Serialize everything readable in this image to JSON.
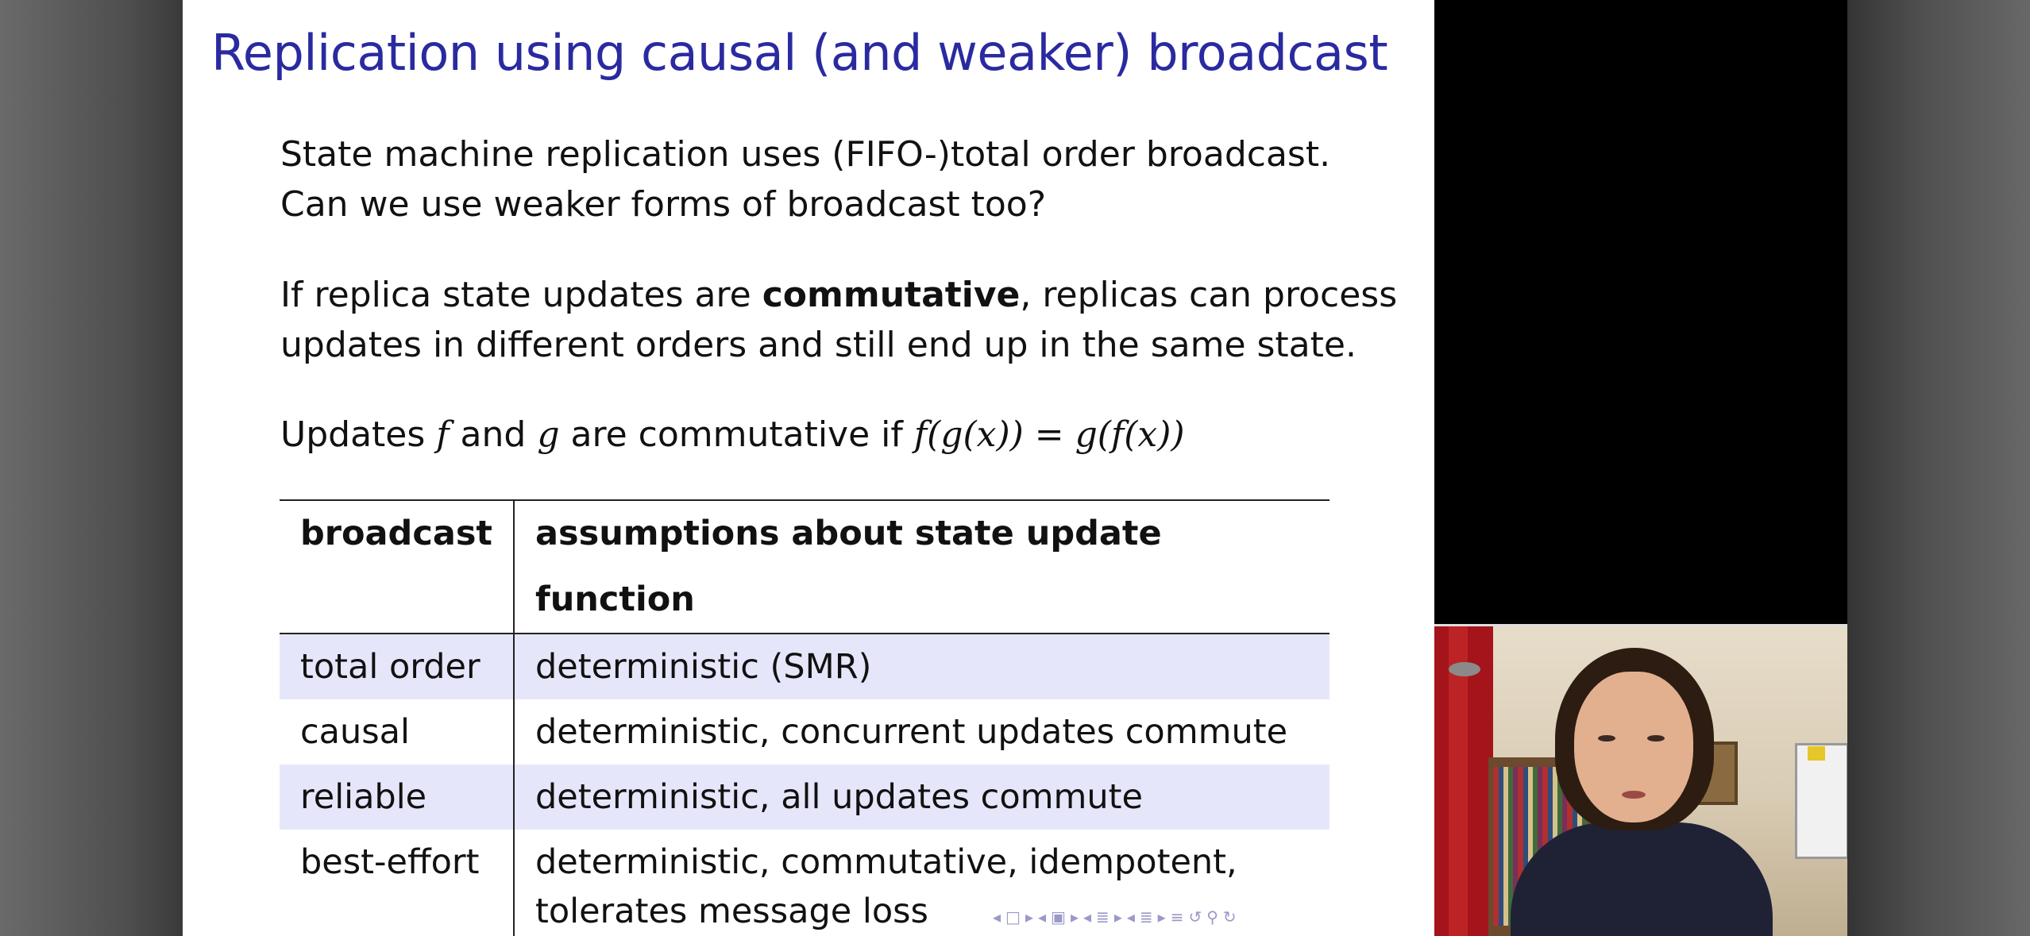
{
  "slide": {
    "title": "Replication using causal (and weaker) broadcast",
    "p1": {
      "line1": "State machine replication uses (FIFO-)total order broadcast.",
      "line2": "Can we use weaker forms of broadcast too?"
    },
    "p2": {
      "line1_before": "If replica state updates are ",
      "line1_bold": "commutative",
      "line1_after": ", replicas can process",
      "line2": "updates in different orders and still end up in the same state."
    },
    "p3": {
      "t1": "Updates ",
      "f": "f",
      "t2": " and ",
      "g": "g",
      "t3": " are commutative if ",
      "formula": "f(g(x)) = g(f(x))"
    },
    "table": {
      "headers": [
        "broadcast",
        "assumptions about state update function"
      ],
      "rows": [
        {
          "broadcast": "total order",
          "assumptions": "deterministic (SMR)",
          "assumptions_line2": ""
        },
        {
          "broadcast": "causal",
          "assumptions": "deterministic, concurrent updates commute",
          "assumptions_line2": ""
        },
        {
          "broadcast": "reliable",
          "assumptions": "deterministic, all updates commute",
          "assumptions_line2": ""
        },
        {
          "broadcast": "best-effort",
          "assumptions": "deterministic, commutative, idempotent,",
          "assumptions_line2": "tolerates message loss"
        }
      ]
    },
    "nav_controls": [
      "◂",
      "□",
      "▸",
      "◂",
      "▣",
      "▸",
      "◂",
      "≣",
      "▸",
      "◂",
      "≣",
      "▸",
      "≡",
      "↺",
      "⚲",
      "↻"
    ]
  },
  "colors": {
    "title": "#2a2aa0",
    "row_shade": "#e6e6fb",
    "text": "#111111"
  },
  "webcam": {
    "content": "presenter-video"
  }
}
